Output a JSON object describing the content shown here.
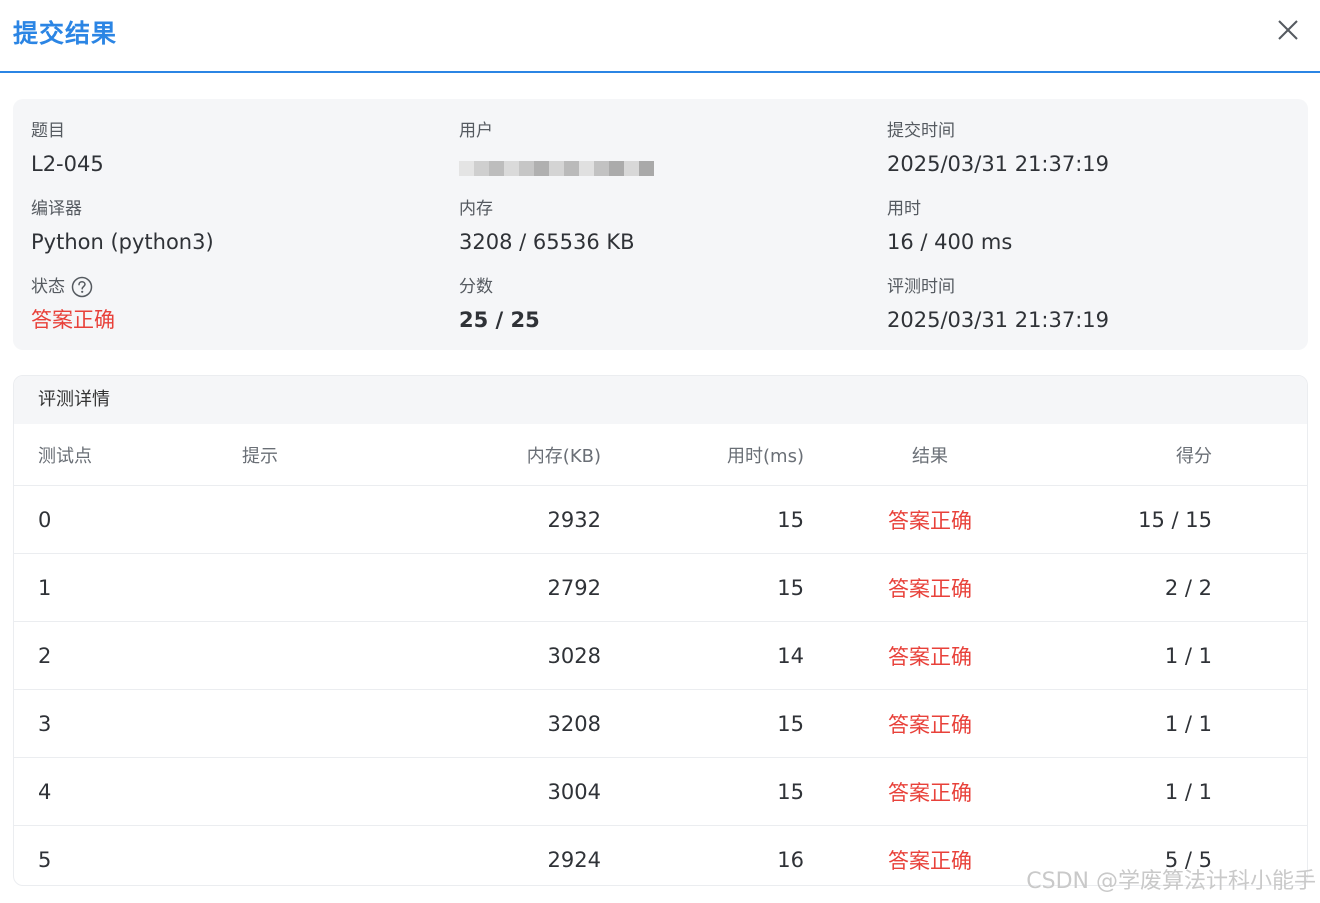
{
  "header": {
    "title": "提交结果"
  },
  "info": {
    "problem_label": "题目",
    "problem_value": "L2-045",
    "user_label": "用户",
    "submit_time_label": "提交时间",
    "submit_time_value": "2025/03/31 21:37:19",
    "compiler_label": "编译器",
    "compiler_value": "Python (python3)",
    "memory_label": "内存",
    "memory_value": "3208 / 65536 KB",
    "time_label": "用时",
    "time_value": "16 / 400 ms",
    "status_label": "状态",
    "status_value": "答案正确",
    "score_label": "分数",
    "score_value": "25 / 25",
    "judge_time_label": "评测时间",
    "judge_time_value": "2025/03/31 21:37:19"
  },
  "details": {
    "title": "评测详情",
    "columns": {
      "case": "测试点",
      "hint": "提示",
      "memory": "内存(KB)",
      "time": "用时(ms)",
      "result": "结果",
      "score": "得分"
    },
    "rows": [
      {
        "case": "0",
        "hint": "",
        "memory": "2932",
        "time": "15",
        "result": "答案正确",
        "score": "15 / 15"
      },
      {
        "case": "1",
        "hint": "",
        "memory": "2792",
        "time": "15",
        "result": "答案正确",
        "score": "2 / 2"
      },
      {
        "case": "2",
        "hint": "",
        "memory": "3028",
        "time": "14",
        "result": "答案正确",
        "score": "1 / 1"
      },
      {
        "case": "3",
        "hint": "",
        "memory": "3208",
        "time": "15",
        "result": "答案正确",
        "score": "1 / 1"
      },
      {
        "case": "4",
        "hint": "",
        "memory": "3004",
        "time": "15",
        "result": "答案正确",
        "score": "1 / 1"
      },
      {
        "case": "5",
        "hint": "",
        "memory": "2924",
        "time": "16",
        "result": "答案正确",
        "score": "5 / 5"
      }
    ]
  },
  "watermark": "CSDN @学废算法计科小能手",
  "colors": {
    "accent": "#2b85e4",
    "accepted": "#e8413a",
    "card_bg": "#f5f6f8"
  },
  "icons": {
    "close": "close-icon",
    "help": "help-icon"
  }
}
